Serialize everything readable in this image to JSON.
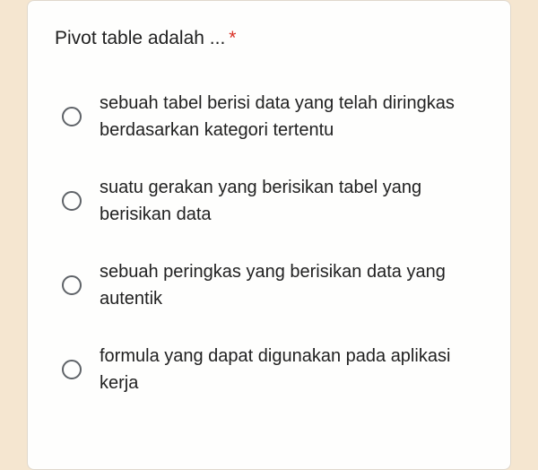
{
  "question": {
    "text": "Pivot table adalah ...",
    "required_marker": "*"
  },
  "options": [
    {
      "label": "sebuah tabel berisi data yang telah diringkas berdasarkan kategori tertentu"
    },
    {
      "label": "suatu gerakan yang berisikan tabel yang berisikan data"
    },
    {
      "label": "sebuah peringkas yang berisikan data yang autentik"
    },
    {
      "label": "formula yang dapat digunakan pada aplikasi kerja"
    }
  ]
}
